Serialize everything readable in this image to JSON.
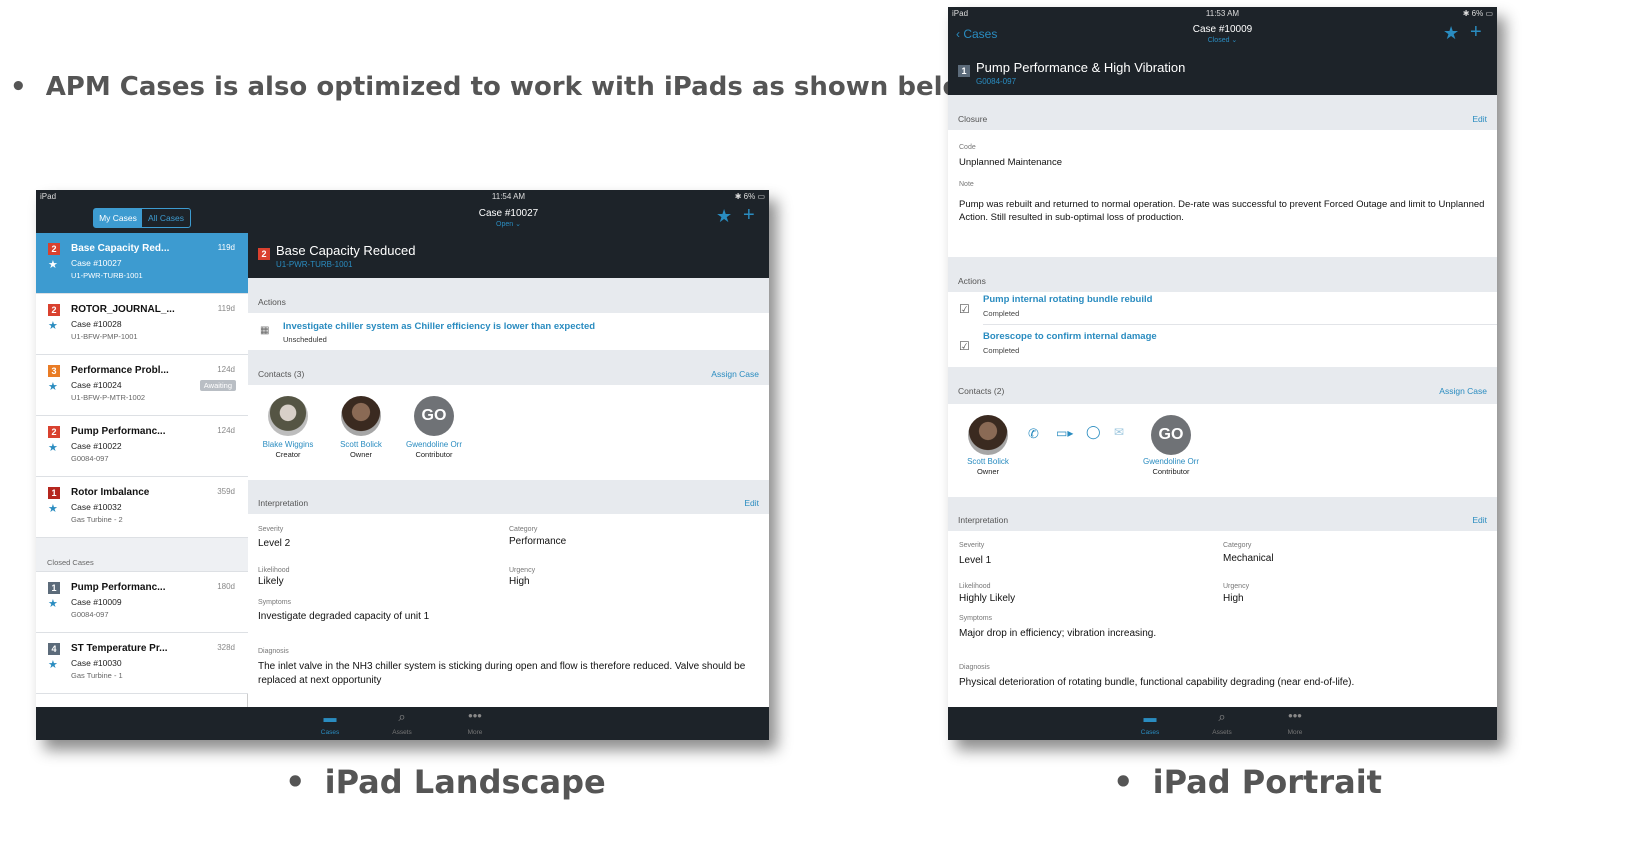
{
  "slide": {
    "bullet_text": "APM Cases is also optimized to work with iPads as shown below",
    "caption_landscape": "iPad Landscape",
    "caption_portrait": "iPad Portrait",
    "bullet_glyph": "•"
  },
  "landscape": {
    "status": {
      "carrier": "iPad",
      "time": "11:54 AM",
      "battery": "6%"
    },
    "segment": {
      "my_cases": "My Cases",
      "all_cases": "All Cases"
    },
    "header": {
      "case_no": "Case #10027",
      "case_state": "Open ⌄"
    },
    "title": {
      "severity": "2",
      "name": "Base Capacity Reduced",
      "asset": "U1-PWR-TURB-1001"
    },
    "cases": [
      {
        "sev": "2",
        "sevColor": "#d9412f",
        "title": "Base Capacity Red...",
        "case": "Case #10027",
        "asset": "U1-PWR-TURB-1001",
        "age": "119d",
        "badge": "",
        "selected": true
      },
      {
        "sev": "2",
        "sevColor": "#d9412f",
        "title": "ROTOR_JOURNAL_...",
        "case": "Case #10028",
        "asset": "U1-BFW-PMP-1001",
        "age": "119d",
        "badge": "",
        "selected": false
      },
      {
        "sev": "3",
        "sevColor": "#e97c25",
        "title": "Performance Probl...",
        "case": "Case #10024",
        "asset": "U1-BFW-P-MTR-1002",
        "age": "124d",
        "badge": "Awaiting",
        "selected": false
      },
      {
        "sev": "2",
        "sevColor": "#d9412f",
        "title": "Pump Performanc...",
        "case": "Case #10022",
        "asset": "G0084-097",
        "age": "124d",
        "badge": "",
        "selected": false
      },
      {
        "sev": "1",
        "sevColor": "#b5261e",
        "title": "Rotor Imbalance",
        "case": "Case #10032",
        "asset": "Gas Turbine - 2",
        "age": "359d",
        "badge": "",
        "selected": false
      }
    ],
    "closed_header": "Closed Cases",
    "closed_cases": [
      {
        "sev": "1",
        "sevColor": "#5c6b7a",
        "title": "Pump Performanc...",
        "case": "Case #10009",
        "asset": "G0084-097",
        "age": "180d"
      },
      {
        "sev": "4",
        "sevColor": "#5c6b7a",
        "title": "ST Temperature Pr...",
        "case": "Case #10030",
        "asset": "Gas Turbine - 1",
        "age": "328d"
      }
    ],
    "actions_header": "Actions",
    "action": {
      "title": "Investigate chiller system as Chiller efficiency is lower than expected",
      "status": "Unscheduled"
    },
    "contacts_header": "Contacts (3)",
    "assign_case": "Assign Case",
    "contacts": [
      {
        "name": "Blake Wiggins",
        "role": "Creator",
        "initials": ""
      },
      {
        "name": "Scott Bolick",
        "role": "Owner",
        "initials": ""
      },
      {
        "name": "Gwendoline Orr",
        "role": "Contributor",
        "initials": "GO"
      }
    ],
    "interpretation_header": "Interpretation",
    "edit": "Edit",
    "fields": {
      "severity_label": "Severity",
      "severity": "Level 2",
      "category_label": "Category",
      "category": "Performance",
      "likelihood_label": "Likelihood",
      "likelihood": "Likely",
      "urgency_label": "Urgency",
      "urgency": "High",
      "symptoms_label": "Symptoms",
      "symptoms": "Investigate degraded capacity of unit 1",
      "diagnosis_label": "Diagnosis",
      "diagnosis": "The inlet valve in the NH3 chiller system is sticking during open and flow is therefore reduced. Valve should be replaced at next opportunity"
    },
    "tabs": {
      "cases": "Cases",
      "assets": "Assets",
      "more": "More"
    }
  },
  "portrait": {
    "status": {
      "carrier": "iPad",
      "time": "11:53 AM",
      "battery": "6%"
    },
    "header": {
      "back": "Cases",
      "case_no": "Case #10009",
      "case_state": "Closed ⌄"
    },
    "title": {
      "severity": "1",
      "name": "Pump Performance & High Vibration",
      "asset": "G0084-097"
    },
    "closure_header": "Closure",
    "edit": "Edit",
    "code_label": "Code",
    "code": "Unplanned Maintenance",
    "note_label": "Note",
    "note": "Pump was rebuilt and returned to normal operation.  De-rate was successful to prevent Forced Outage and limit to Unplanned Action.  Still resulted in sub-optimal loss of production.",
    "actions_header": "Actions",
    "actions": [
      {
        "title": "Pump internal rotating bundle rebuild",
        "status": "Completed"
      },
      {
        "title": "Borescope to confirm internal damage",
        "status": "Completed"
      }
    ],
    "contacts_header": "Contacts (2)",
    "assign_case": "Assign Case",
    "contacts": [
      {
        "name": "Scott Bolick",
        "role": "Owner",
        "initials": ""
      },
      {
        "name": "Gwendoline Orr",
        "role": "Contributor",
        "initials": "GO"
      }
    ],
    "interpretation_header": "Interpretation",
    "fields": {
      "severity_label": "Severity",
      "severity": "Level 1",
      "category_label": "Category",
      "category": "Mechanical",
      "likelihood_label": "Likelihood",
      "likelihood": "Highly Likely",
      "urgency_label": "Urgency",
      "urgency": "High",
      "symptoms_label": "Symptoms",
      "symptoms": "Major drop in efficiency; vibration increasing.",
      "diagnosis_label": "Diagnosis",
      "diagnosis": "Physical deterioration of rotating bundle, functional capability degrading (near end-of-life)."
    },
    "tabs": {
      "cases": "Cases",
      "assets": "Assets",
      "more": "More"
    }
  },
  "colors": {
    "accent": "#2a8cc0",
    "dark": "#1d2329",
    "selected": "#3d9bd0"
  }
}
